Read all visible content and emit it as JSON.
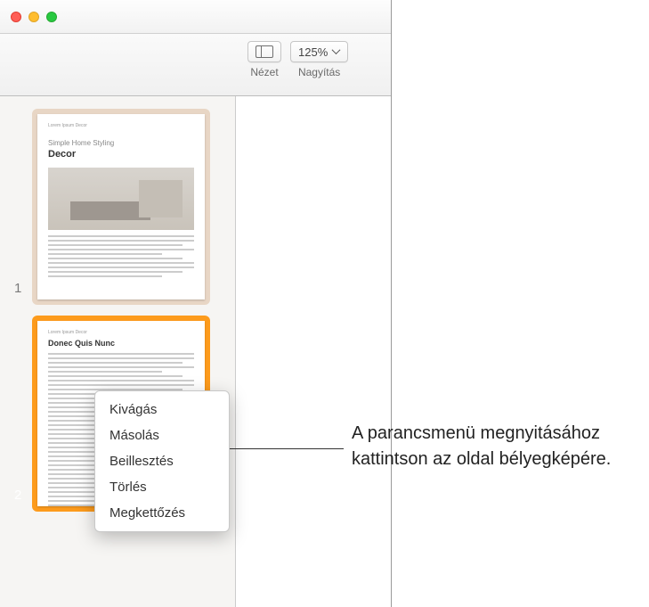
{
  "toolbar": {
    "view_label": "Nézet",
    "zoom_label": "Nagyítás",
    "zoom_value": "125%"
  },
  "sidebar": {
    "thumbnails": [
      {
        "number": "1",
        "top_label": "Lorem Ipsum Decor",
        "subtitle": "Simple Home Styling",
        "title": "Decor"
      },
      {
        "number": "2",
        "top_label": "Lorem Ipsum Decor",
        "heading": "Donec Quis Nunc"
      }
    ]
  },
  "context_menu": {
    "items": [
      "Kivágás",
      "Másolás",
      "Beillesztés",
      "Törlés",
      "Megkettőzés"
    ]
  },
  "callout": {
    "text": "A parancsmenü megnyitásához kattintson az oldal bélyegképére."
  }
}
